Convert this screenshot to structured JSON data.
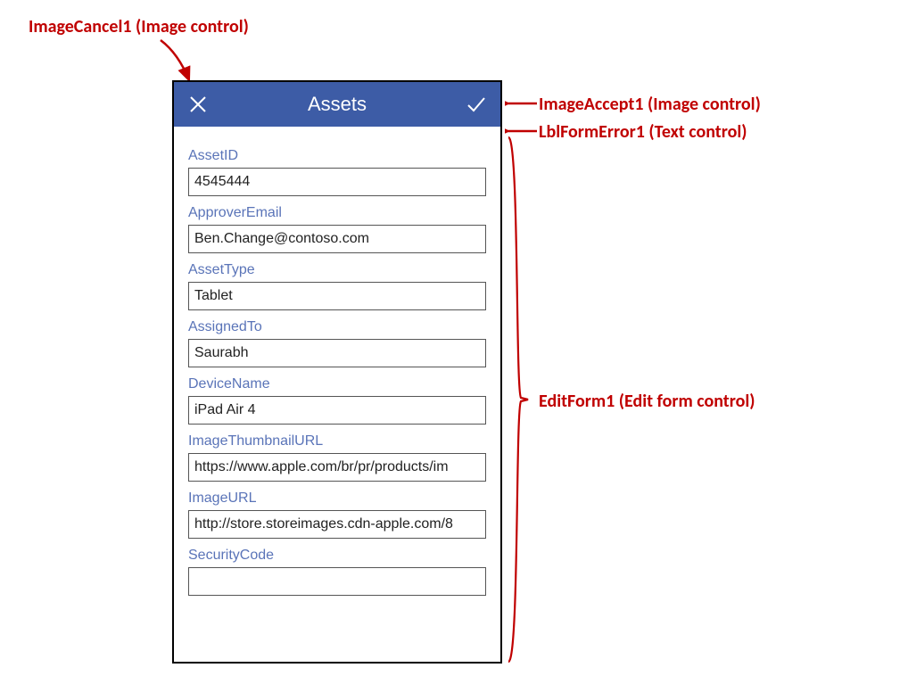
{
  "annotations": {
    "cancel": "ImageCancel1 (Image control)",
    "accept": "ImageAccept1 (Image control)",
    "error_label": "LblFormError1 (Text control)",
    "edit_form": "EditForm1 (Edit form control)"
  },
  "header": {
    "title": "Assets",
    "cancel_icon": "close-icon",
    "accept_icon": "check-icon"
  },
  "form": {
    "error_text": "",
    "fields": [
      {
        "label": "AssetID",
        "value": "4545444"
      },
      {
        "label": "ApproverEmail",
        "value": "Ben.Change@contoso.com"
      },
      {
        "label": "AssetType",
        "value": "Tablet"
      },
      {
        "label": "AssignedTo",
        "value": "Saurabh"
      },
      {
        "label": "DeviceName",
        "value": "iPad Air 4"
      },
      {
        "label": "ImageThumbnailURL",
        "value": "https://www.apple.com/br/pr/products/im"
      },
      {
        "label": "ImageURL",
        "value": "http://store.storeimages.cdn-apple.com/8"
      },
      {
        "label": "SecurityCode",
        "value": ""
      }
    ]
  },
  "colors": {
    "header_bg": "#3d5ca6",
    "label_color": "#5a74b8",
    "annotation_color": "#C00000"
  }
}
